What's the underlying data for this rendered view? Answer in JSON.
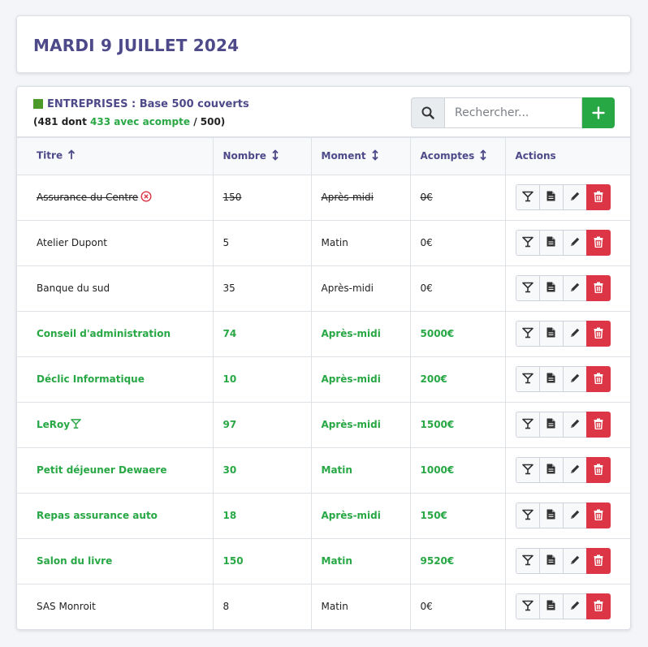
{
  "page": {
    "title": "MARDI 9 JUILLET 2024"
  },
  "section": {
    "title": "ENTREPRISES : Base 500 couverts",
    "sub_prefix": "(481 dont ",
    "sub_green": "433 avec acompte",
    "sub_suffix": " / 500)",
    "accent_color": "#4c9a2a"
  },
  "search": {
    "placeholder": "Rechercher...",
    "icon": "search-icon"
  },
  "add_button": {
    "icon": "plus-icon",
    "color": "#28a745"
  },
  "table": {
    "headers": [
      "Titre",
      "Nombre",
      "Moment",
      "Acomptes",
      "Actions"
    ],
    "sort_icons": [
      "arrow-up-icon",
      "sort-vertical-icon",
      "sort-vertical-icon",
      "sort-vertical-icon"
    ],
    "rows": [
      {
        "titre": "Assurance du Centre",
        "nombre": "150",
        "moment": "Après-midi",
        "acomptes": "0€",
        "status": "cancelled"
      },
      {
        "titre": "Atelier Dupont",
        "nombre": "5",
        "moment": "Matin",
        "acomptes": "0€",
        "status": "normal"
      },
      {
        "titre": "Banque du sud",
        "nombre": "35",
        "moment": "Après-midi",
        "acomptes": "0€",
        "status": "normal"
      },
      {
        "titre": "Conseil d'administration",
        "nombre": "74",
        "moment": "Après-midi",
        "acomptes": "5000€",
        "status": "done"
      },
      {
        "titre": "Déclic Informatique",
        "nombre": "10",
        "moment": "Après-midi",
        "acomptes": "200€",
        "status": "done"
      },
      {
        "titre": "LeRoy",
        "nombre": "97",
        "moment": "Après-midi",
        "acomptes": "1500€",
        "status": "done",
        "cocktail": true
      },
      {
        "titre": "Petit déjeuner Dewaere",
        "nombre": "30",
        "moment": "Matin",
        "acomptes": "1000€",
        "status": "done"
      },
      {
        "titre": "Repas assurance auto",
        "nombre": "18",
        "moment": "Après-midi",
        "acomptes": "150€",
        "status": "done"
      },
      {
        "titre": "Salon du livre",
        "nombre": "150",
        "moment": "Matin",
        "acomptes": "9520€",
        "status": "done"
      },
      {
        "titre": "SAS Monroit",
        "nombre": "8",
        "moment": "Matin",
        "acomptes": "0€",
        "status": "normal"
      }
    ],
    "row_actions": [
      "cocktail-icon",
      "document-icon",
      "pencil-icon",
      "trash-icon"
    ]
  },
  "colors": {
    "heading": "#4e4a8a",
    "success": "#28a745",
    "danger": "#dc3545"
  }
}
